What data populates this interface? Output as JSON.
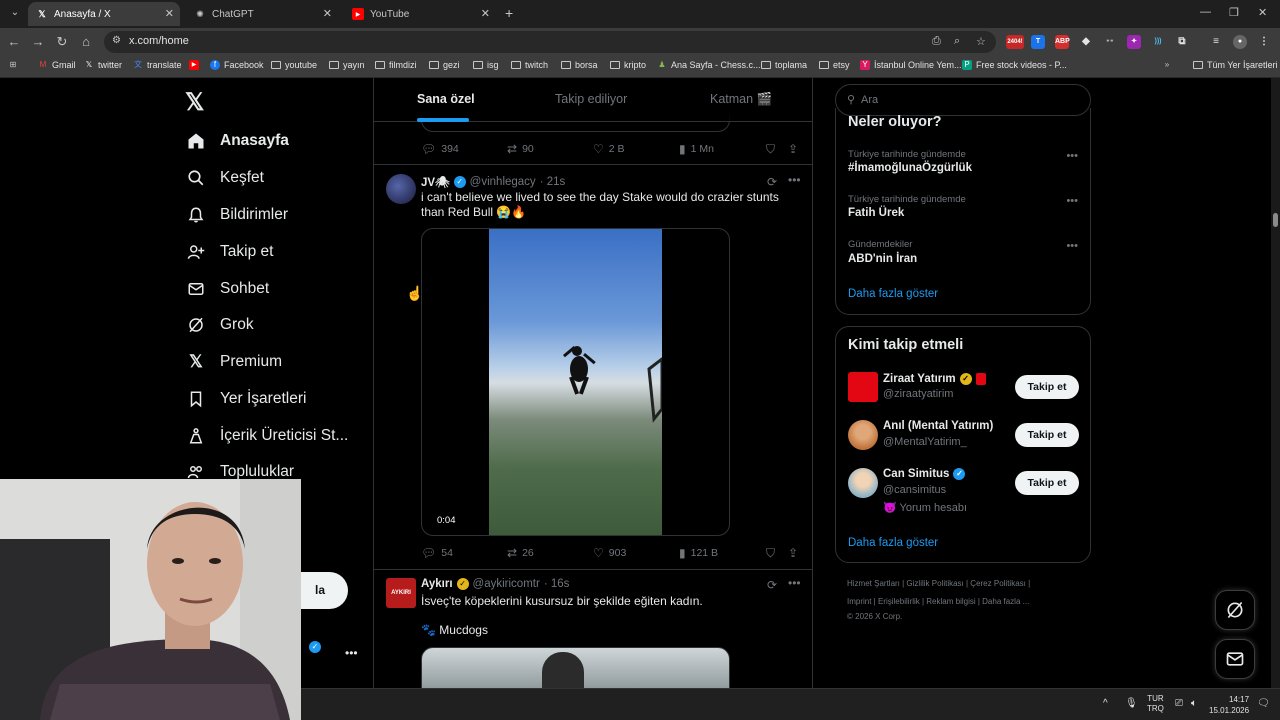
{
  "browser": {
    "tabs": [
      {
        "title": "Anasayfa / X"
      },
      {
        "title": "ChatGPT"
      },
      {
        "title": "YouTube"
      }
    ],
    "url": "x.com/home",
    "bookmarks": [
      "Gmail",
      "twitter",
      "translate",
      "Facebook",
      "youtube",
      "yayın",
      "filmdizi",
      "gezi",
      "isg",
      "twitch",
      "borsa",
      "kripto",
      "Ana Sayfa - Chess.c...",
      "toplama",
      "etsy",
      "İstanbul Online Yem...",
      "Free stock videos - P..."
    ],
    "all_bookmarks": "Tüm Yer İşaretleri",
    "ext_badge": "2404!"
  },
  "nav": {
    "items": [
      {
        "label": "Anasayfa",
        "icon": "home-icon"
      },
      {
        "label": "Keşfet",
        "icon": "search-icon"
      },
      {
        "label": "Bildirimler",
        "icon": "bell-icon"
      },
      {
        "label": "Takip et",
        "icon": "person-add-icon"
      },
      {
        "label": "Sohbet",
        "icon": "mail-icon"
      },
      {
        "label": "Grok",
        "icon": "grok-icon"
      },
      {
        "label": "Premium",
        "icon": "x-icon"
      },
      {
        "label": "Yer İşaretleri",
        "icon": "bookmark-icon"
      },
      {
        "label": "İçerik Üreticisi St...",
        "icon": "creator-icon"
      },
      {
        "label": "Topluluklar",
        "icon": "community-icon"
      }
    ]
  },
  "feed": {
    "tabs": [
      "Sana özel",
      "Takip ediliyor",
      "Katman 🎬"
    ],
    "prev_tweet_stats": {
      "replies": "394",
      "reposts": "90",
      "likes": "2 B",
      "views": "1 Mn"
    },
    "tweet1": {
      "name": "JV🕷",
      "handle": "@vinhlegacy",
      "time": "· 21s",
      "text": "i can't believe we lived to see the day Stake would do crazier stunts than Red Bull 😭🔥",
      "duration": "0:04",
      "stats": {
        "replies": "54",
        "reposts": "26",
        "likes": "903",
        "views": "121 B"
      }
    },
    "tweet2": {
      "name": "Aykırı",
      "handle": "@aykiricomtr",
      "time": "· 16s",
      "text": "İsveç'te köpeklerini kusursuz bir şekilde eğiten kadın.",
      "subtext": "🐾 Mucdogs",
      "avatar_text": "AYKIRI"
    }
  },
  "search": {
    "placeholder": "Ara"
  },
  "trends": {
    "title": "Neler oluyor?",
    "items": [
      {
        "context": "Türkiye tarihinde gündemde",
        "name": "#İmamoğlunaÖzgürlük"
      },
      {
        "context": "Türkiye tarihinde gündemde",
        "name": "Fatih Ürek"
      },
      {
        "context": "Gündemdekiler",
        "name": "ABD'nin İran"
      }
    ],
    "show_more": "Daha fazla göster"
  },
  "who_to_follow": {
    "title": "Kimi takip etmeli",
    "users": [
      {
        "name": "Ziraat Yatırım",
        "handle": "@ziraatyatirim"
      },
      {
        "name": "Anıl (Mental Yatırım)",
        "handle": "@MentalYatirim_"
      },
      {
        "name": "Can Simitus",
        "handle": "@cansimitus",
        "note": "😈 Yorum hesabı"
      }
    ],
    "follow_label": "Takip et",
    "show_more": "Daha fazla göster"
  },
  "footer": {
    "line1": "Hizmet Şartları  |  Gizlilik Politikası  |  Çerez Politikası  |",
    "line2": "Imprint  |  Erişilebilirlik  |  Reklam bilgisi  |  Daha fazla ...",
    "line3": "© 2026 X Corp."
  },
  "sidebar_partial": {
    "post_button": "la"
  },
  "taskbar": {
    "lang_top": "TUR",
    "lang_bottom": "TRQ",
    "time": "14:17",
    "date": "15.01.2026"
  },
  "colors": {
    "accent": "#1d9bf0",
    "background": "#000000",
    "text": "#e7e9ea",
    "muted": "#71767b",
    "border": "#2f3336"
  }
}
